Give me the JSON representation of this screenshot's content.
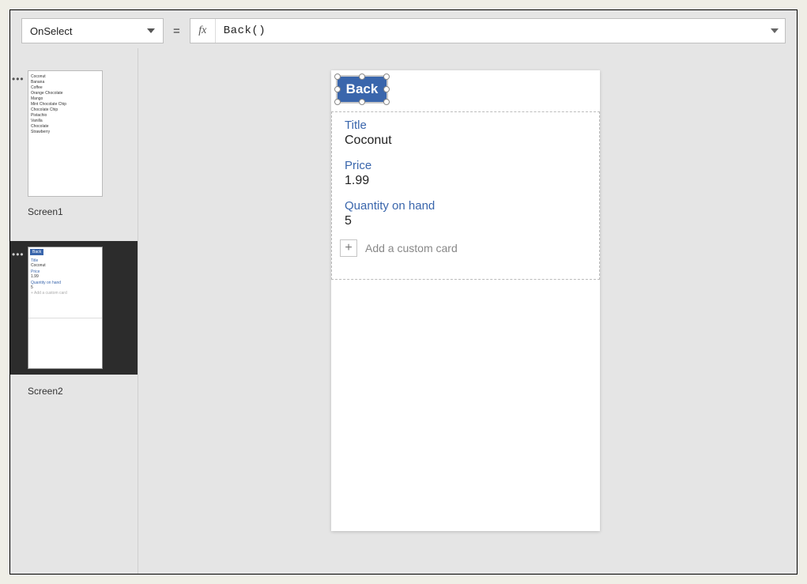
{
  "formula_bar": {
    "property": "OnSelect",
    "equals": "=",
    "fx_label": "fx",
    "expression": "Back()"
  },
  "screens": {
    "screen1": {
      "label": "Screen1",
      "items": [
        "Coconut",
        "Banana",
        "Coffee",
        "Orange Chocolate",
        "Mango",
        "Mint Chocolate Chip",
        "Chocolate Chip",
        "Pistachio",
        "Vanilla",
        "Chocolate",
        "Strawberry"
      ]
    },
    "screen2": {
      "label": "Screen2",
      "back": "Back",
      "title_label": "Title",
      "title_value": "Coconut",
      "price_label": "Price",
      "price_value": "1.99",
      "qty_label": "Quantity on hand",
      "qty_value": "5",
      "add_custom": "+  Add a custom card"
    }
  },
  "canvas": {
    "back_button": "Back",
    "cards": [
      {
        "label": "Title",
        "value": "Coconut"
      },
      {
        "label": "Price",
        "value": "1.99"
      },
      {
        "label": "Quantity on hand",
        "value": "5"
      }
    ],
    "add_custom_label": "Add a custom card",
    "plus": "+"
  }
}
